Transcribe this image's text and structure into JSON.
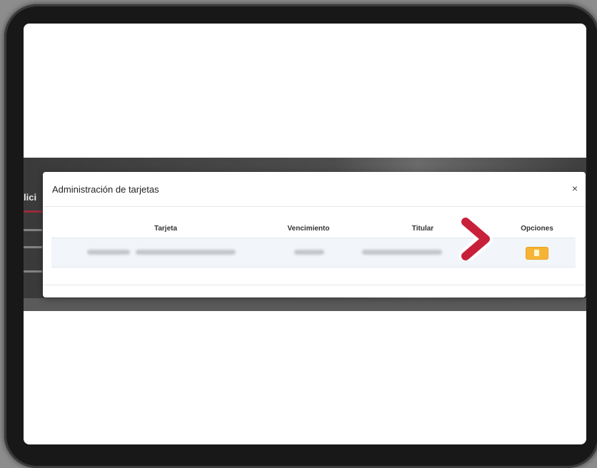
{
  "modal": {
    "title": "Administración de tarjetas",
    "close_label": "×"
  },
  "table": {
    "columns": [
      "Tarjeta",
      "Vencimiento",
      "Titular",
      "Opciones"
    ]
  },
  "background_page": {
    "heading_fragment": "lici"
  },
  "icons": {
    "close": "close-icon",
    "edit": "pencil-icon",
    "pointer": "chevron-right-icon"
  },
  "colors": {
    "accent_arrow": "#c8203a",
    "option_button": "#f6b436"
  }
}
